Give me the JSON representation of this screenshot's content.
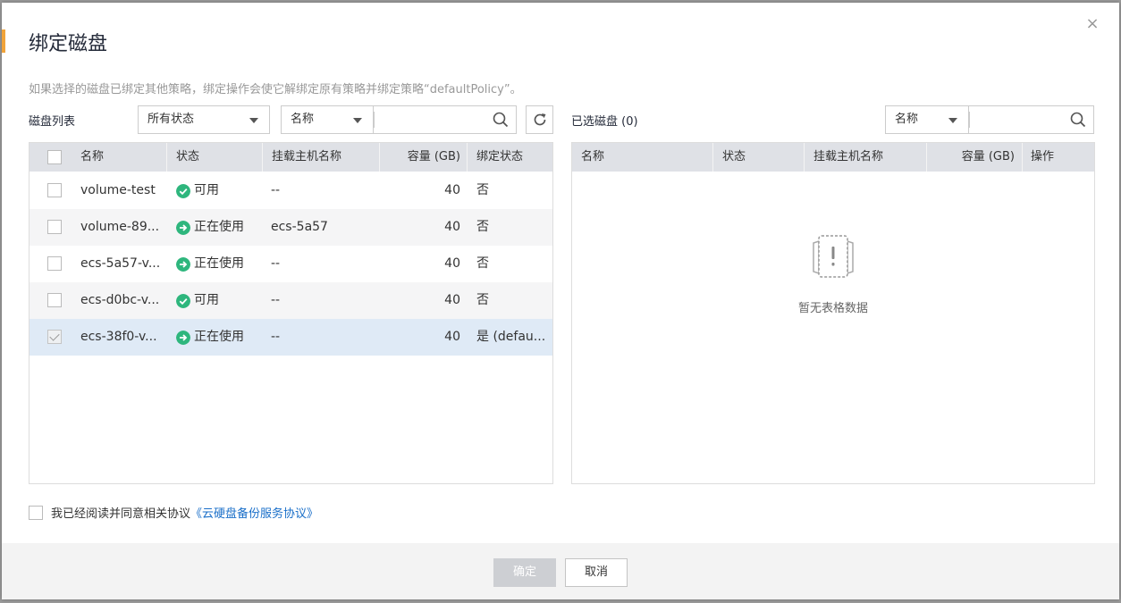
{
  "dialog": {
    "title": "绑定磁盘",
    "close_glyph": "×",
    "notice": "如果选择的磁盘已绑定其他策略，绑定操作会使它解绑定原有策略并绑定策略“defaultPolicy”。"
  },
  "left": {
    "label": "磁盘列表",
    "status_filter": "所有状态",
    "search_field": "名称",
    "search_placeholder": "",
    "columns": [
      "名称",
      "状态",
      "挂载主机名称",
      "容量 (GB)",
      "绑定状态"
    ],
    "rows": [
      {
        "name": "volume-test",
        "status": "可用",
        "status_type": "available",
        "host": "--",
        "capacity": "40",
        "bind": "否",
        "checked": false
      },
      {
        "name": "volume-89...",
        "status": "正在使用",
        "status_type": "in-use",
        "host": "ecs-5a57",
        "capacity": "40",
        "bind": "否",
        "checked": false
      },
      {
        "name": "ecs-5a57-v...",
        "status": "正在使用",
        "status_type": "in-use",
        "host": "--",
        "capacity": "40",
        "bind": "否",
        "checked": false
      },
      {
        "name": "ecs-d0bc-v...",
        "status": "可用",
        "status_type": "available",
        "host": "--",
        "capacity": "40",
        "bind": "否",
        "checked": false
      },
      {
        "name": "ecs-38f0-v...",
        "status": "正在使用",
        "status_type": "in-use",
        "host": "--",
        "capacity": "40",
        "bind": "是 (defau...",
        "checked": true
      }
    ]
  },
  "right": {
    "label": "已选磁盘 (0)",
    "search_field": "名称",
    "columns": [
      "名称",
      "状态",
      "挂载主机名称",
      "容量 (GB)",
      "操作"
    ],
    "empty_text": "暂无表格数据"
  },
  "agreement": {
    "prefix": "我已经阅读并同意相关协议",
    "link": "《云硬盘备份服务协议》"
  },
  "footer": {
    "ok_label": "确定",
    "cancel_label": "取消"
  },
  "colors": {
    "accent": "#f0a33a",
    "status_green": "#2eb67d",
    "link": "#1a6fc9"
  }
}
